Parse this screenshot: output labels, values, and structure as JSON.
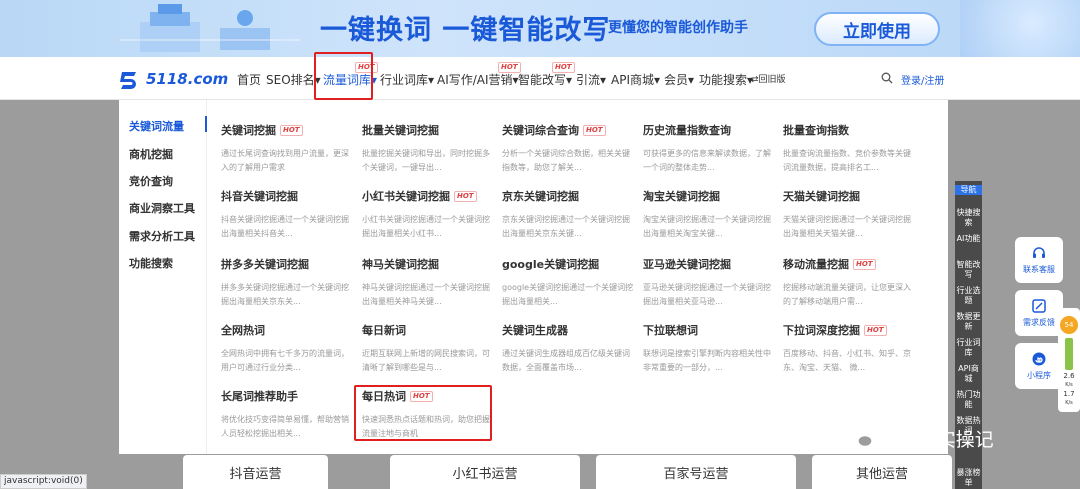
{
  "banner": {
    "slogan": "一键换词 一键智能改写",
    "subtitle": "更懂您的智能创作助手",
    "cta": "立即使用"
  },
  "logo": {
    "text": "5118.com"
  },
  "nav": {
    "items": [
      {
        "label": "首页"
      },
      {
        "label": "SEO排名▾"
      },
      {
        "label": "流量词库▾",
        "hot": "HOT"
      },
      {
        "label": "行业词库▾"
      },
      {
        "label": "AI写作/AI营销▾",
        "hot": "HOT"
      },
      {
        "label": "智能改写▾",
        "hot": "HOT"
      },
      {
        "label": "引流▾"
      },
      {
        "label": "API商城▾"
      },
      {
        "label": "会员▾"
      },
      {
        "label": "功能搜索▾"
      },
      {
        "label": "⇄回旧版"
      }
    ],
    "login": "登录/注册",
    "search_icon": "search-icon"
  },
  "sidebar": {
    "items": [
      {
        "label": "关键词流量"
      },
      {
        "label": "商机挖掘"
      },
      {
        "label": "竞价查询"
      },
      {
        "label": "商业洞察工具"
      },
      {
        "label": "需求分析工具"
      },
      {
        "label": "功能搜索"
      }
    ]
  },
  "tools": [
    {
      "title": "关键词挖掘",
      "tag": "HOT",
      "desc": "通过长尾词查询找到用户流量，更深入的了解用户需求"
    },
    {
      "title": "批量关键词挖掘",
      "tag": "",
      "desc": "批量挖掘关键词和导出，同时挖掘多个关键词，一键导出..."
    },
    {
      "title": "关键词综合查询",
      "tag": "HOT",
      "desc": "分析一个关键词综合数据，相关关键指数等，助您了解关..."
    },
    {
      "title": "历史流量指数查询",
      "tag": "",
      "desc": "可获得更多的信息来解读数据，了解一个词的整体走势..."
    },
    {
      "title": "批量查询指数",
      "tag": "",
      "desc": "批量查询流量指数、竞价参数等关键词流量数据，提高排名工..."
    },
    {
      "title": "抖音关键词挖掘",
      "tag": "",
      "desc": "抖音关键词挖掘通过一个关键词挖掘出海量相关抖音关..."
    },
    {
      "title": "小红书关键词挖掘",
      "tag": "HOT",
      "desc": "小红书关键词挖掘通过一个关键词挖掘出海量相关小红书..."
    },
    {
      "title": "京东关键词挖掘",
      "tag": "",
      "desc": "京东关键词挖掘通过一个关键词挖掘出海量相关京东关键..."
    },
    {
      "title": "淘宝关键词挖掘",
      "tag": "",
      "desc": "淘宝关键词挖掘通过一个关键词挖掘出海量相关淘宝关键..."
    },
    {
      "title": "天猫关键词挖掘",
      "tag": "",
      "desc": "天猫关键词挖掘通过一个关键词挖掘出海量相关天猫关键..."
    },
    {
      "title": "拼多多关键词挖掘",
      "tag": "",
      "desc": "拼多多关键词挖掘通过一个关键词挖掘出海量相关京东关..."
    },
    {
      "title": "神马关键词挖掘",
      "tag": "",
      "desc": "神马关键词挖掘通过一个关键词挖掘出海量相关神马关键..."
    },
    {
      "title": "google关键词挖掘",
      "tag": "",
      "desc": "google关键词挖掘通过一个关键词挖掘出海量相关..."
    },
    {
      "title": "亚马逊关键词挖掘",
      "tag": "",
      "desc": "亚马逊关键词挖掘通过一个关键词挖掘出海量相关亚马逊..."
    },
    {
      "title": "移动流量挖掘",
      "tag": "HOT",
      "desc": "挖掘移动端流量关键词，让您更深入的了解移动端用户需..."
    },
    {
      "title": "全网热词",
      "tag": "",
      "desc": "全网热词中拥有七千多万的流量词，用户可通过行业分类..."
    },
    {
      "title": "每日新词",
      "tag": "",
      "desc": "近期互联网上新增的网民搜索词，可清晰了解到哪些是与..."
    },
    {
      "title": "关键词生成器",
      "tag": "",
      "desc": "通过关键词生成器组成百亿级关键词数据，全面覆盖市场..."
    },
    {
      "title": "下拉联想词",
      "tag": "",
      "desc": "联想词是搜索引擎判断内容相关性中非常重要的一部分，..."
    },
    {
      "title": "下拉词深度挖掘",
      "tag": "HOT",
      "desc": "百度移动、抖音、小红书、知乎、京东、淘宝、天猫、 微..."
    },
    {
      "title": "长尾词推荐助手",
      "tag": "",
      "desc": "将优化技巧变得简单易懂，帮助营销人员轻松挖掘出相关..."
    },
    {
      "title": "每日热词",
      "tag": "HOT",
      "desc": "快速洞悉热点话题和热词，助您把握流量注地与商机"
    }
  ],
  "background_tabs": [
    {
      "label": "抖音运营"
    },
    {
      "label": "小红书运营"
    },
    {
      "label": "百家号运营"
    },
    {
      "label": "其他运营"
    }
  ],
  "nav_rail": {
    "items": [
      {
        "label": "导航"
      },
      {
        "label": "快捷搜索"
      },
      {
        "label": "AI功能"
      },
      {
        "label": "智能改写"
      },
      {
        "label": "行业选题"
      },
      {
        "label": "数据更新"
      },
      {
        "label": "行业词库"
      },
      {
        "label": "API商城"
      },
      {
        "label": "热门功能"
      },
      {
        "label": "数据热词"
      },
      {
        "label": "暴涨榜单"
      }
    ]
  },
  "service": {
    "items": [
      {
        "label": "联系客服",
        "icon": "headset-icon"
      },
      {
        "label": "需求反馈",
        "icon": "feedback-icon"
      },
      {
        "label": "小程序",
        "icon": "miniprogram-icon"
      }
    ]
  },
  "speed": {
    "up": "2.6",
    "down": "1.7",
    "unit": "K/s",
    "pct": "54"
  },
  "watermark": "赤辰AI实操记",
  "statusbar": "javascript:void(0)",
  "colors": {
    "brand_blue": "#1a5ad8",
    "hot_red": "#e04040",
    "highlight_red": "#e02020",
    "rail_selected": "#2d73e6"
  }
}
